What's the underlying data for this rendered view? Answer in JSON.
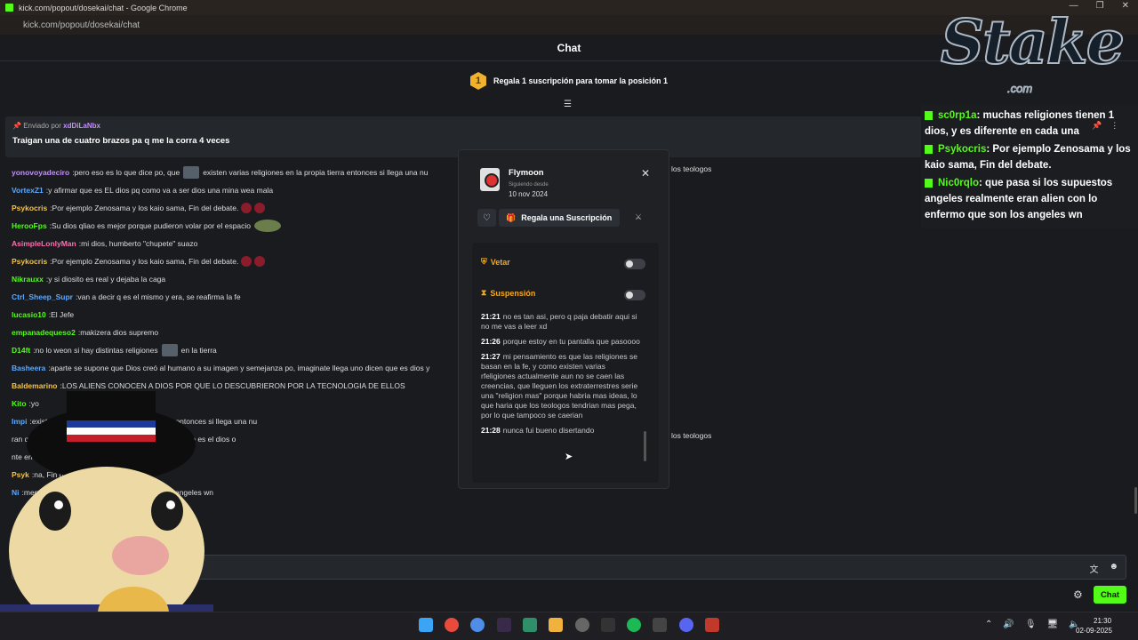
{
  "browser": {
    "title": "kick.com/popout/dosekai/chat - Google Chrome",
    "url": "kick.com/popout/dosekai/chat",
    "controls": [
      "—",
      "❐",
      "✕"
    ]
  },
  "chat_header": {
    "title": "Chat"
  },
  "gift_banner": {
    "medal": "1",
    "text": "Regala 1 suscripción para tomar la posición 1"
  },
  "pinned": {
    "sent_by_label": "Enviado por",
    "sent_by_user": "xdDiLaNbx",
    "message": "Traigan una de cuatro brazos pa q me la corra 4 veces"
  },
  "messages": [
    {
      "user": "yonovoyadeciro",
      "color": "#c291f7",
      "text": "pero eso es lo que dice po, que",
      "emote": true,
      "after": "existen varias religiones en la propia tierra entonces si llega una nu"
    },
    {
      "user": "VortexZ1",
      "color": "#5aa9ff",
      "text": "y afirmar que es EL dios pq como va a ser dios una mina wea mala"
    },
    {
      "user": "Psykocris",
      "color": "#f6c343",
      "text": "Por ejemplo Zenosama y los kaio sama, Fin del debate.",
      "roses": true
    },
    {
      "user": "HerooFps",
      "color": "#53fc18",
      "text": "Su dios qliao es mejor porque pudieron volar por el espacio",
      "frog": true
    },
    {
      "user": "AsimpleLonlyMan",
      "color": "#ff6fb0",
      "text": "mi dios, humberto \"chupete\" suazo"
    },
    {
      "user": "Psykocris",
      "color": "#f6c343",
      "text": "Por ejemplo Zenosama y los kaio sama, Fin del debate.",
      "roses": true
    },
    {
      "user": "Nikrauxx",
      "color": "#53fc18",
      "text": "y si diosito es real y dejaba la caga"
    },
    {
      "user": "Ctrl_Sheep_Supr",
      "color": "#5aa9ff",
      "text": "van a decir q es el mismo y era, se reafirma la fe"
    },
    {
      "user": "lucasio10",
      "color": "#53fc18",
      "text": "El Jefe"
    },
    {
      "user": "empanadequeso2",
      "color": "#53fc18",
      "text": "makizera dios supremo"
    },
    {
      "user": "D14ft",
      "color": "#53fc18",
      "text": "no lo weon si hay distintas religiones",
      "emote": true,
      "after": "en la tierra"
    },
    {
      "user": "Basheera",
      "color": "#5aa9ff",
      "text": "aparte se supone que Dios creó al humano a su imagen y semejanza po, imaginate llega uno dicen que es dios y"
    },
    {
      "user": "Baldemarino",
      "color": "#f6c343",
      "text": "LOS ALIENS CONOCEN A DIOS POR QUE LO DESCUBRIERON POR LA TECNOLOGIA DE ELLOS"
    },
    {
      "user": "Kito",
      "color": "#53fc18",
      "text": "yo"
    },
    {
      "user": "Impi",
      "color": "#5aa9ff",
      "text": "existen varias religiones en la propia tierra entonces si llega una nu"
    },
    {
      "user": "",
      "color": "#ddd",
      "text": "ran que la biblia",
      "emote": true,
      "after": "decia eso y los extraterrestre no es el dios o"
    },
    {
      "user": "",
      "color": "#ddd",
      "text": "nte en cada una"
    },
    {
      "user": "Psyk",
      "color": "#f6c343",
      "text": "na, Fin del debate.",
      "roses": true
    },
    {
      "user": "Ni",
      "color": "#5aa9ff",
      "text": "mente eran alien con lo enfermo que son los angeles wn"
    }
  ],
  "extra_text": {
    "teologos1": "los teologos",
    "teologos2": "los teologos"
  },
  "composer": {
    "placeholder": "",
    "icons": [
      "文",
      "☻"
    ]
  },
  "chat_button": "Chat",
  "popup": {
    "name": "Flymoon",
    "since_label": "Siguiendo desde",
    "since": "10 nov 2024",
    "gift_label": "Regala una Suscripción",
    "veto_label": "Vetar",
    "suspension_label": "Suspensión",
    "history": [
      {
        "time": "21:21",
        "text": "no es tan asi, pero q paja debatir aqui si no me vas a leer xd"
      },
      {
        "time": "21:26",
        "text": "porque estoy en tu pantalla que pasoooo"
      },
      {
        "time": "21:27",
        "text": "mi pensamiento es que las religiones se basan en la fe, y como existen varias rfeligiones actualmente aun no se caen las creencias, que lleguen los extraterrestres serie una \"religion mas\" porque habria mas ideas, lo que haria que los teologos tendrian mas pega, por lo que tampoco se caerian"
      },
      {
        "time": "21:28",
        "text": "nunca fui bueno disertando"
      }
    ]
  },
  "stake": {
    "word": "Stake",
    "com": ".com"
  },
  "overlay": [
    {
      "user": "sc0rp1a",
      "text": ": muchas religiones tienen 1 dios, y es diferente en cada una"
    },
    {
      "user": "Psykocris",
      "text": ": Por ejemplo Zenosama y los kaio sama, Fin del debate."
    },
    {
      "user": "Nic0rqlo",
      "text": ": que pasa si los supuestos angeles realmente eran alien con lo enfermo que son los angeles wn"
    }
  ],
  "clock": {
    "time": "21:30",
    "date": "02-09-2025"
  },
  "colors": {
    "kick_green": "#53fc18",
    "background": "#191b1f",
    "accent_orange": "#f6a81b"
  }
}
